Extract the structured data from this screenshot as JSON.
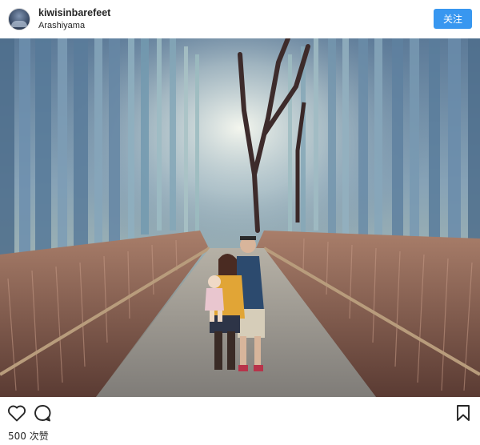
{
  "post": {
    "username": "kiwisinbarefeet",
    "location": "Arashiyama",
    "follow_label": "关注",
    "likes_count": "500",
    "likes_unit": "次赞"
  },
  "photo": {
    "description_hidden": true
  },
  "icons": {
    "like": "heart-icon",
    "comment": "comment-icon",
    "save": "bookmark-icon"
  },
  "colors": {
    "accent": "#3897f0",
    "text": "#262626"
  }
}
